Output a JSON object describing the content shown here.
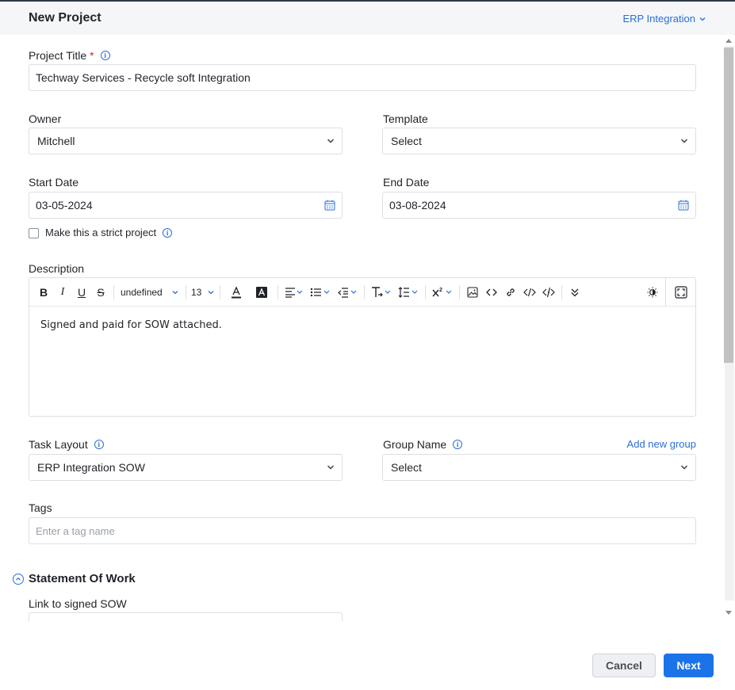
{
  "header": {
    "title": "New Project",
    "layout_label": "ERP Integration"
  },
  "form": {
    "project_title": {
      "label": "Project Title",
      "required_mark": "*",
      "value": "Techway Services - Recycle soft Integration"
    },
    "owner": {
      "label": "Owner",
      "value": "Mitchell"
    },
    "template": {
      "label": "Template",
      "value": "Select"
    },
    "start_date": {
      "label": "Start Date",
      "value": "03-05-2024"
    },
    "end_date": {
      "label": "End Date",
      "value": "03-08-2024"
    },
    "strict": {
      "label": "Make this a strict project",
      "checked": false
    },
    "description": {
      "label": "Description",
      "font_family": "undefined",
      "font_size": "13",
      "text": "Signed and paid for SOW attached."
    },
    "task_layout": {
      "label": "Task Layout",
      "value": "ERP Integration SOW"
    },
    "group_name": {
      "label": "Group Name",
      "value": "Select",
      "add_link": "Add new group"
    },
    "tags": {
      "label": "Tags",
      "placeholder": "Enter a tag name"
    },
    "sow_section": {
      "title": "Statement Of Work",
      "link_label": "Link to signed SOW"
    }
  },
  "footer": {
    "cancel_label": "Cancel",
    "next_label": "Next"
  },
  "colors": {
    "accent": "#1a73e8",
    "link": "#2a6fd6",
    "required": "#e02020"
  }
}
